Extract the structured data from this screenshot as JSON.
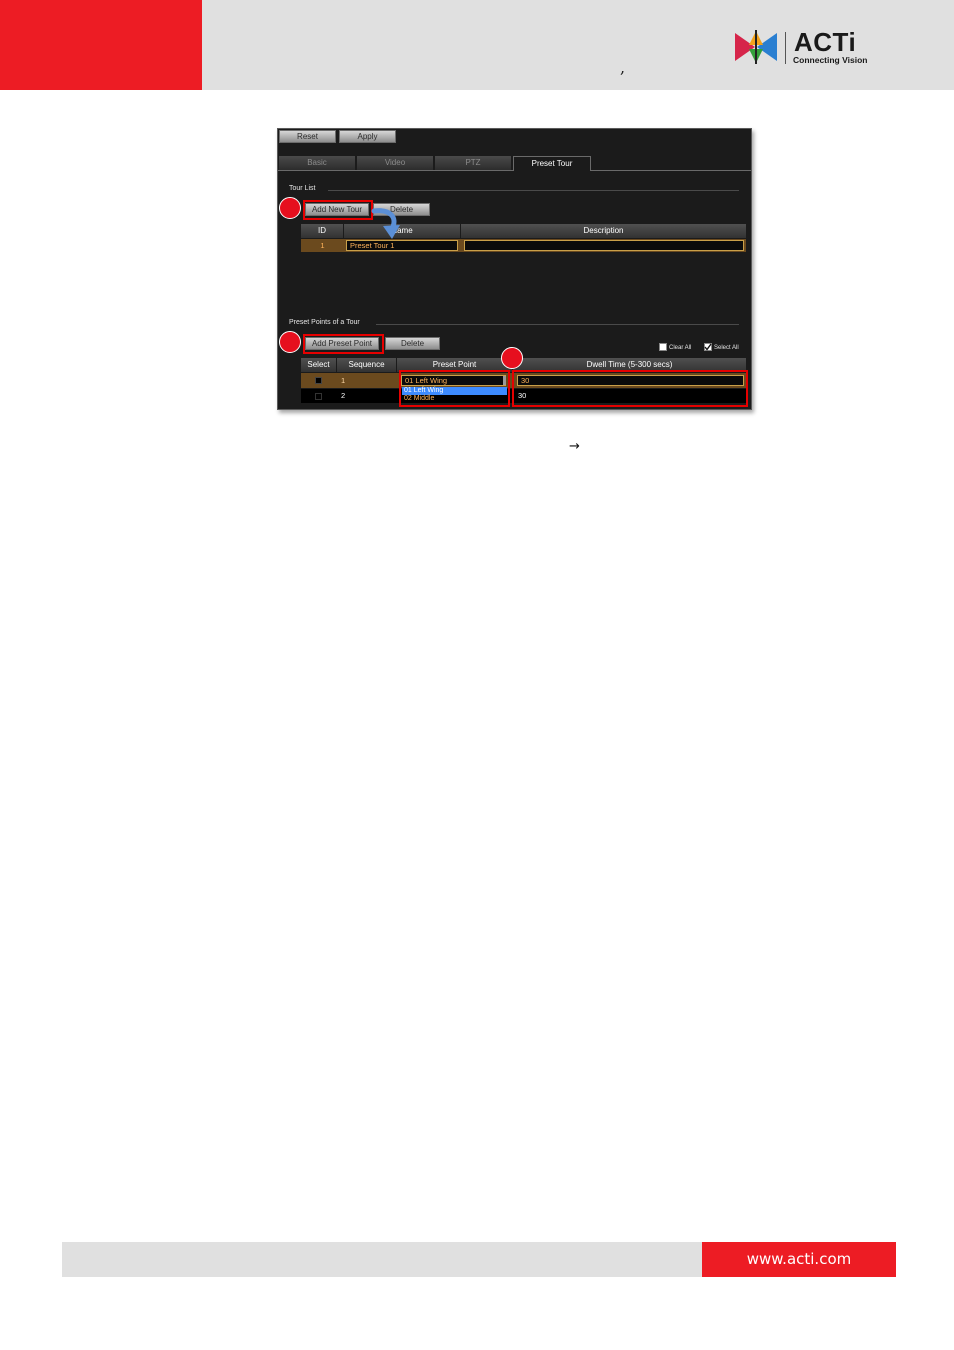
{
  "header": {
    "comma": ",",
    "brand_name": "ACTi",
    "brand_tagline": "Connecting Vision"
  },
  "screenshot": {
    "buttons": {
      "reset": "Reset",
      "apply": "Apply"
    },
    "tabs": [
      {
        "label": "Basic",
        "active": false
      },
      {
        "label": "Video",
        "active": false
      },
      {
        "label": "PTZ",
        "active": false
      },
      {
        "label": "Preset Tour",
        "active": true
      }
    ],
    "tour_list": {
      "title": "Tour List",
      "add_button": "Add New Tour",
      "delete_button": "Delete",
      "columns": [
        "ID",
        "Name",
        "Description"
      ],
      "rows": [
        {
          "id": "1",
          "name": "Preset Tour 1",
          "description": ""
        }
      ]
    },
    "preset_points": {
      "title": "Preset Points of a Tour",
      "add_button": "Add Preset Point",
      "delete_button": "Delete",
      "clear_all": "Clear All",
      "select_all": "Select All",
      "clear_all_checked": false,
      "select_all_checked": true,
      "columns": [
        "Select",
        "Sequence",
        "Preset Point",
        "Dwell Time (5-300 secs)"
      ],
      "rows": [
        {
          "sequence": "1",
          "preset": "01 Left Wing",
          "dwell": "30"
        },
        {
          "sequence": "2",
          "preset": "",
          "dwell": "30"
        }
      ],
      "dropdown_options": [
        "01 Left Wing",
        "02 Middle"
      ]
    }
  },
  "caption": {
    "arrow": "→"
  },
  "footer": {
    "url": "www.acti.com"
  },
  "colors": {
    "brand_red": "#ed1c24",
    "highlight_red": "#e60000",
    "header_gray": "#e0e0e0",
    "dropdown_blue": "#3d8bff"
  }
}
